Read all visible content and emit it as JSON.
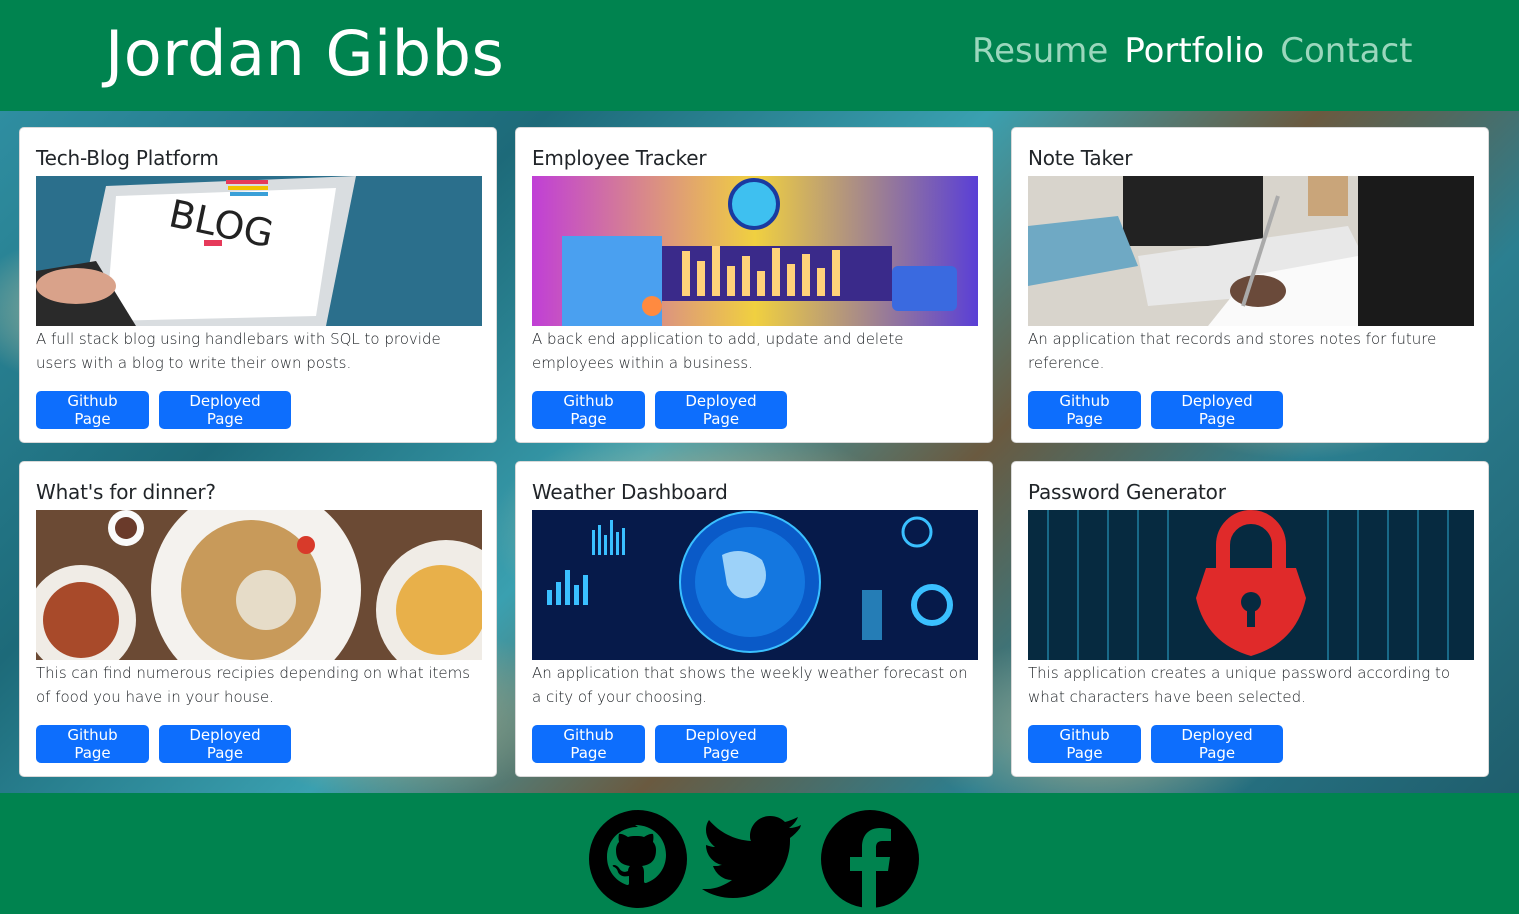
{
  "header": {
    "brand": "Jordan Gibbs",
    "nav": [
      {
        "label": "Resume",
        "active": false
      },
      {
        "label": "Portfolio",
        "active": true
      },
      {
        "label": "Contact",
        "active": false
      }
    ]
  },
  "colors": {
    "header_bg": "#00834f",
    "button": "#0d6efd",
    "nav_active": "#ffffff",
    "nav_inactive": "#9bd7bd"
  },
  "projects": [
    {
      "title": "Tech-Blog Platform",
      "description": "A full stack blog using handlebars with SQL to provide users with a blog to write their own posts.",
      "image_icon": "laptop-blog-image",
      "github": "Github Page",
      "deployed": "Deployed Page"
    },
    {
      "title": "Employee Tracker",
      "description": "A back end application to add, update and delete employees within a business.",
      "image_icon": "team-illustration-image",
      "github": "Github Page",
      "deployed": "Deployed Page"
    },
    {
      "title": "Note Taker",
      "description": "An application that records and stores notes for future reference.",
      "image_icon": "writing-notes-image",
      "github": "Github Page",
      "deployed": "Deployed Page"
    },
    {
      "title": "What's for dinner?",
      "description": "This can find numerous recipies depending on what items of food you have in your house.",
      "image_icon": "dinner-plates-image",
      "github": "Github Page",
      "deployed": "Deployed Page"
    },
    {
      "title": "Weather Dashboard",
      "description": "An application that shows the weekly weather forecast on a city of your choosing.",
      "image_icon": "globe-dashboard-image",
      "github": "Github Page",
      "deployed": "Deployed Page"
    },
    {
      "title": "Password Generator",
      "description": "This application creates a unique password according to what characters have been selected.",
      "image_icon": "padlock-image",
      "github": "Github Page",
      "deployed": "Deployed Page"
    }
  ],
  "footer": {
    "icons": [
      "github-icon",
      "twitter-icon",
      "facebook-icon"
    ]
  }
}
